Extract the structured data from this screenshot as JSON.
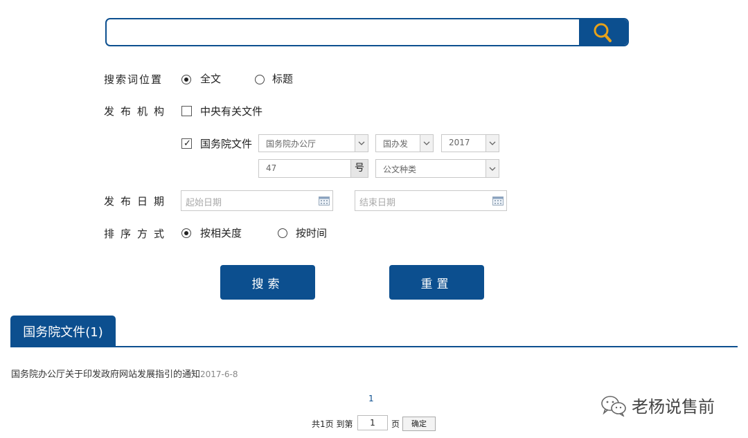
{
  "search": {
    "placeholder": "",
    "value": ""
  },
  "position": {
    "label": "搜索词位置",
    "options": [
      {
        "label": "全文",
        "selected": true
      },
      {
        "label": "标题",
        "selected": false
      }
    ]
  },
  "org": {
    "label": "发布机构",
    "central": {
      "label": "中央有关文件",
      "checked": false
    },
    "state_council": {
      "label": "国务院文件",
      "checked": true
    },
    "dept": "国务院办公厅",
    "doc_prefix": "国办发",
    "year": "2017",
    "number": "47",
    "number_suffix": "号",
    "doc_type": "公文种类"
  },
  "date": {
    "label": "发布日期",
    "start_placeholder": "起始日期",
    "end_placeholder": "结束日期"
  },
  "sort": {
    "label": "排序方式",
    "options": [
      {
        "label": "按相关度",
        "selected": true
      },
      {
        "label": "按时间",
        "selected": false
      }
    ]
  },
  "buttons": {
    "search": "搜索",
    "reset": "重置"
  },
  "results": {
    "tab_label": "国务院文件(1)",
    "items": [
      {
        "title": "国务院办公厅关于印发政府网站发展指引的通知",
        "date": "2017-6-8"
      }
    ]
  },
  "pagination": {
    "current_page": "1",
    "total_text": "共1页 到第",
    "goto_value": "1",
    "page_suffix": "页",
    "confirm_label": "确定"
  },
  "watermark": {
    "text": "老杨说售前"
  },
  "colors": {
    "primary": "#0c4f8f",
    "icon_gold": "#e8a21a"
  }
}
